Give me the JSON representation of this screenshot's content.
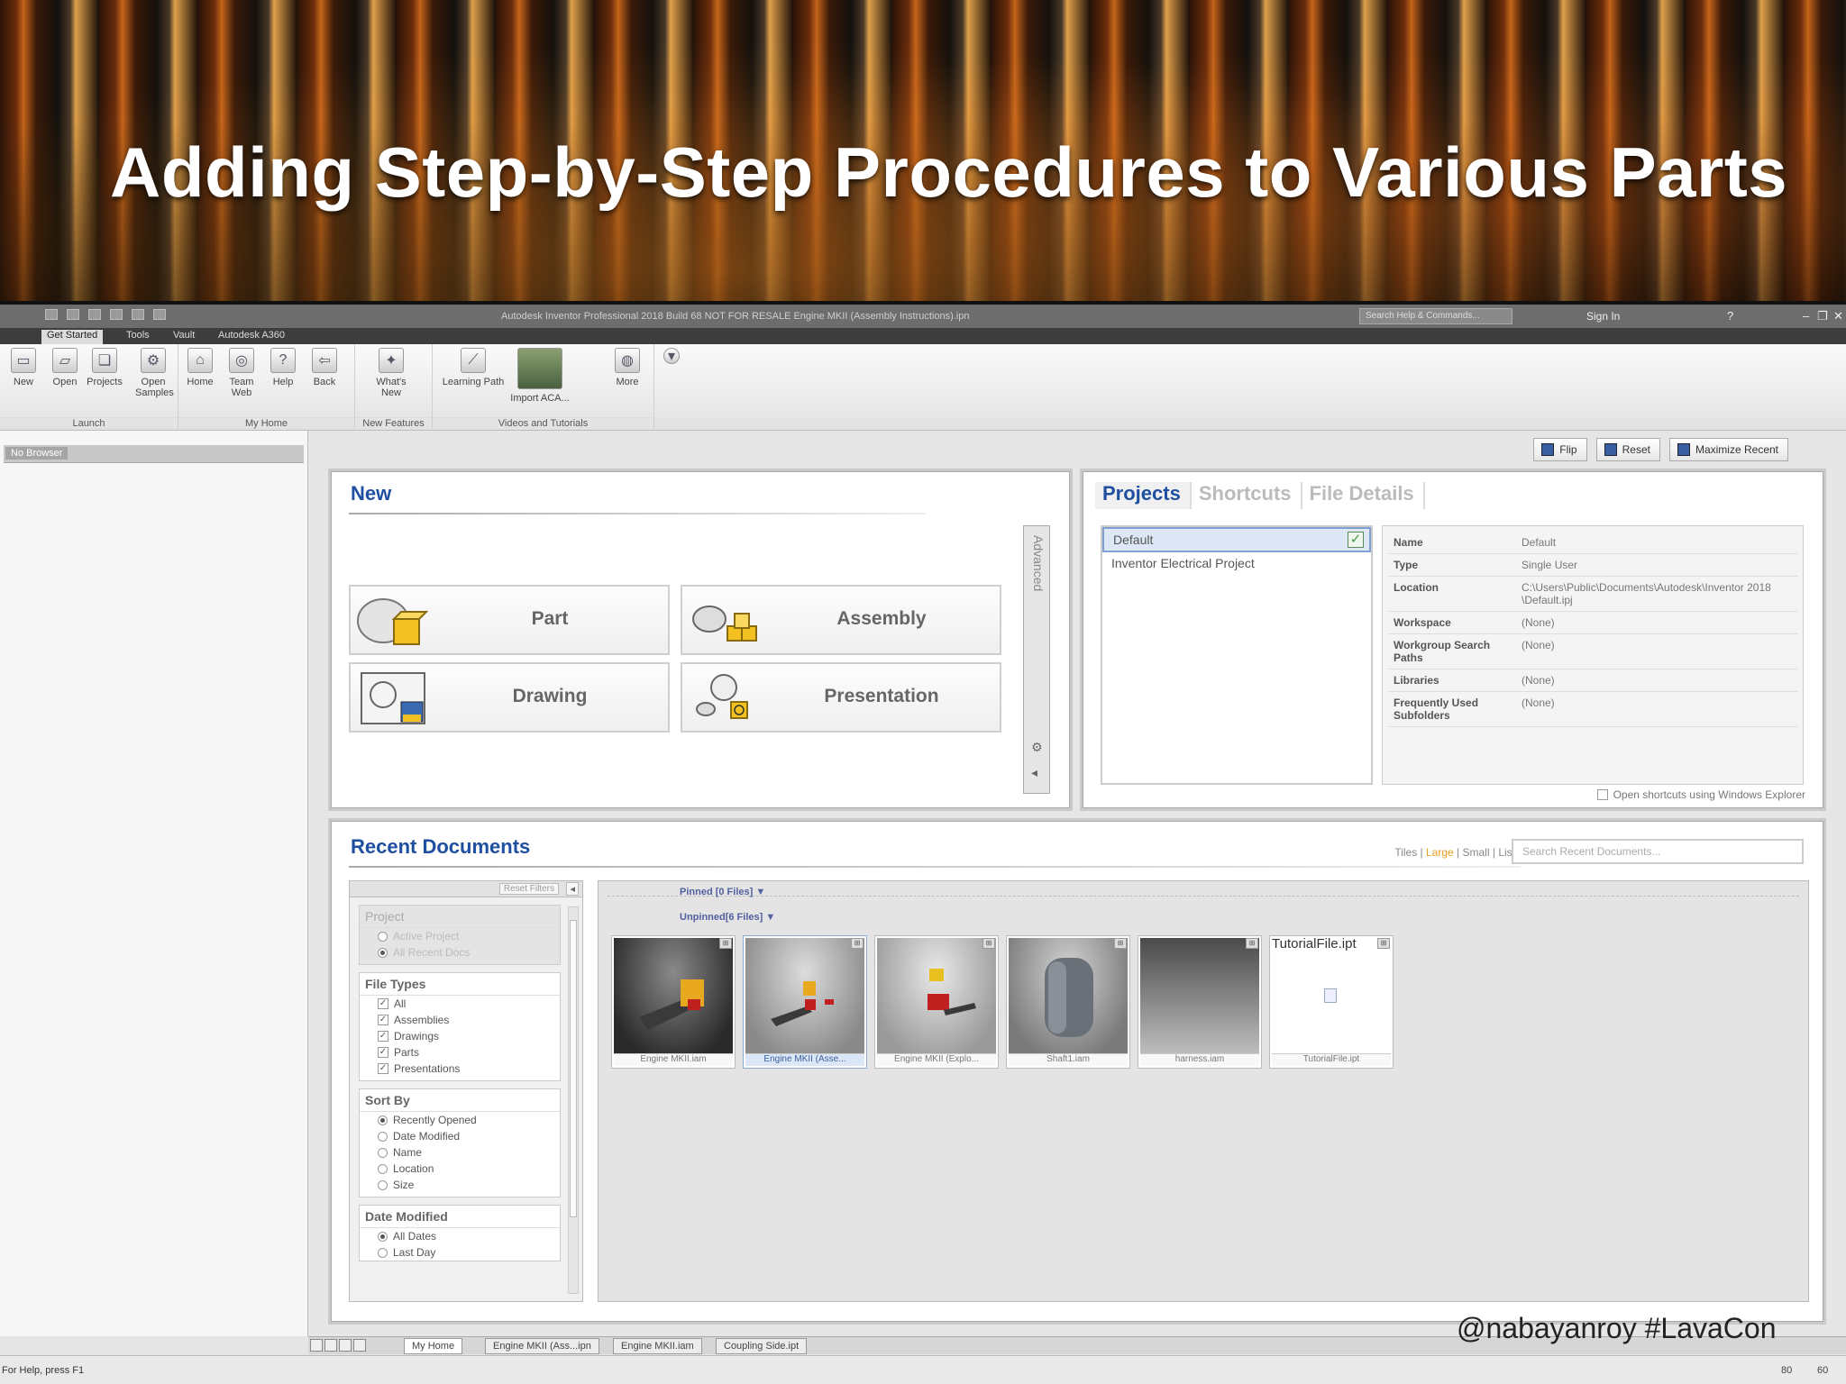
{
  "banner": {
    "title": "Adding Step-by-Step Procedures to Various Parts"
  },
  "titlebar": {
    "window_title": "Autodesk Inventor Professional 2018 Build 68   NOT FOR RESALE   Engine MKII (Assembly Instructions).ipn",
    "search_placeholder": "Search Help & Commands...",
    "sign_in": "Sign In"
  },
  "ribbon_tabs": [
    "Get Started",
    "Tools",
    "Vault",
    "Autodesk A360"
  ],
  "ribbon": {
    "launch": {
      "label": "Launch",
      "buttons": [
        "New",
        "Open",
        "Projects",
        "Open Samples"
      ]
    },
    "my_home": {
      "label": "My Home",
      "buttons": [
        "Home",
        "Team Web",
        "Help",
        "Back"
      ]
    },
    "new_features": {
      "label": "New Features",
      "buttons": [
        "What's New"
      ]
    },
    "videos": {
      "label": "Videos and Tutorials",
      "buttons": [
        "Learning Path",
        "Import ACA...",
        "More"
      ]
    }
  },
  "browser": {
    "header": "No Browser"
  },
  "top_buttons": [
    "Flip",
    "Reset",
    "Maximize Recent"
  ],
  "new_panel": {
    "title": "New",
    "tiles": [
      "Part",
      "Assembly",
      "Drawing",
      "Presentation"
    ],
    "advanced": "Advanced"
  },
  "projects_panel": {
    "tabs": [
      "Projects",
      "Shortcuts",
      "File Details"
    ],
    "projects": [
      "Default",
      "Inventor Electrical Project"
    ],
    "properties": [
      {
        "k": "Name",
        "v": "Default"
      },
      {
        "k": "Type",
        "v": "Single User"
      },
      {
        "k": "Location",
        "v": "C:\\Users\\Public\\Documents\\Autodesk\\Inventor 2018 \\Default.ipj"
      },
      {
        "k": "Workspace",
        "v": "(None)"
      },
      {
        "k": "Workgroup Search Paths",
        "v": "(None)"
      },
      {
        "k": "Libraries",
        "v": "(None)"
      },
      {
        "k": "Frequently Used Subfolders",
        "v": "(None)"
      }
    ],
    "shortcut_option": "Open shortcuts using Windows Explorer"
  },
  "recent_panel": {
    "title": "Recent Documents",
    "view_modes": {
      "tiles": "Tiles",
      "large": "Large",
      "small": "Small",
      "list": "List"
    },
    "search_placeholder": "Search Recent Documents...",
    "filters": {
      "reset": "Reset Filters",
      "project": {
        "title": "Project",
        "options": [
          "Active Project",
          "All Recent Docs"
        ]
      },
      "file_types": {
        "title": "File Types",
        "options": [
          "All",
          "Assemblies",
          "Drawings",
          "Parts",
          "Presentations"
        ]
      },
      "sort_by": {
        "title": "Sort By",
        "options": [
          "Recently Opened",
          "Date Modified",
          "Name",
          "Location",
          "Size"
        ]
      },
      "date_modified": {
        "title": "Date Modified",
        "options": [
          "All Dates",
          "Last Day"
        ]
      }
    },
    "pinned": "Pinned [0 Files] ▼",
    "unpinned": "Unpinned[6 Files] ▼",
    "files": [
      "Engine MKII.iam",
      "Engine MKII (Asse...",
      "Engine MKII (Explo...",
      "Shaft1.iam",
      "harness.iam",
      "TutorialFile.ipt"
    ],
    "tutorial_top": "TutorialFile.ipt"
  },
  "doc_tabs": [
    "My Home",
    "Engine MKII (Ass...ipn",
    "Engine MKII.iam",
    "Coupling Side.ipt"
  ],
  "status": {
    "text": "For Help, press F1",
    "n1": "80",
    "n2": "60"
  },
  "handle": "@nabayanroy #LavaCon",
  "colors": {
    "accent": "#1f4fa0",
    "ribbon_bg": "#e2e2e2",
    "titlebar_bg": "#6d6d6d"
  }
}
